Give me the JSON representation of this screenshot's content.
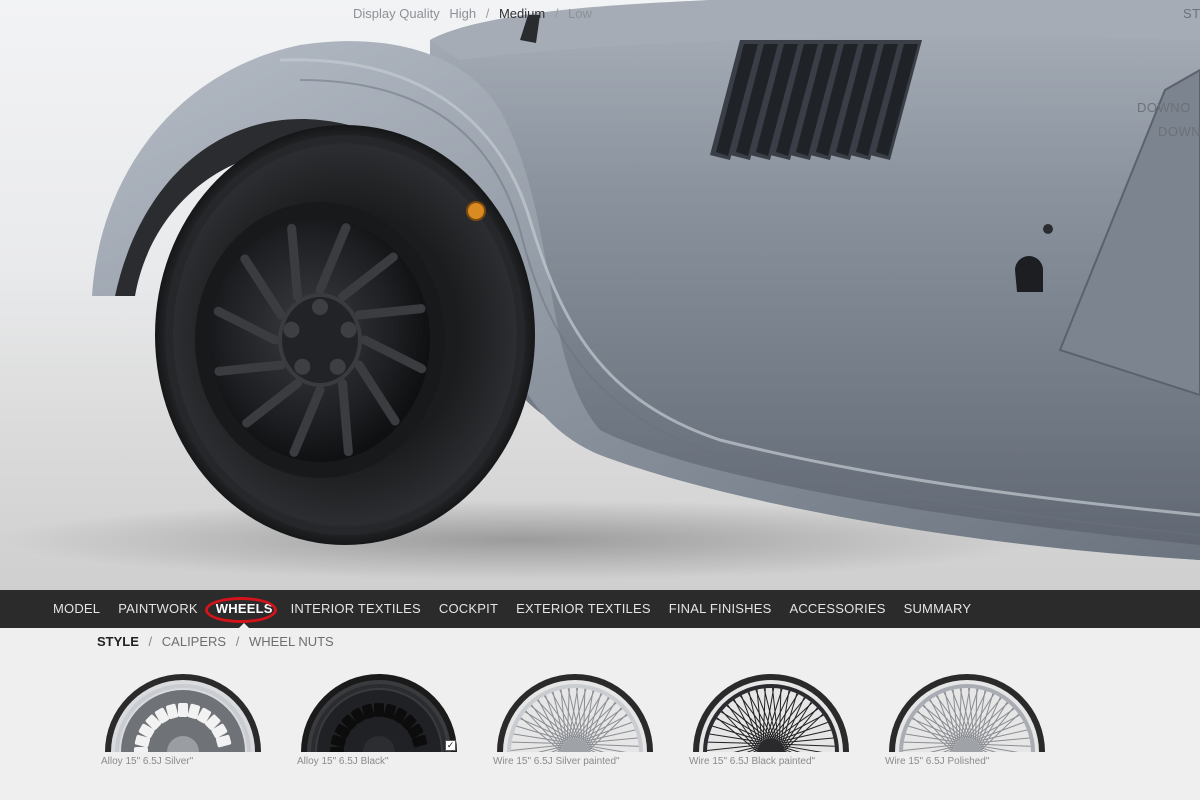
{
  "display_quality": {
    "label": "Display Quality",
    "options": [
      "High",
      "Medium",
      "Low"
    ],
    "selected": "Medium",
    "separator": "/"
  },
  "corner_top_text": "ST",
  "download_links": [
    "DOWNO",
    "DOWN"
  ],
  "main_nav": {
    "items": [
      "MODEL",
      "PAINTWORK",
      "WHEELS",
      "INTERIOR TEXTILES",
      "COCKPIT",
      "EXTERIOR TEXTILES",
      "FINAL FINISHES",
      "ACCESSORIES",
      "SUMMARY"
    ],
    "active": "WHEELS",
    "highlight_color": "#d4131b"
  },
  "sub_nav": {
    "items": [
      "STYLE",
      "CALIPERS",
      "WHEEL NUTS"
    ],
    "active": "STYLE",
    "separator": "/"
  },
  "wheels": [
    {
      "label": "Alloy 15\" 6.5J Silver\"",
      "type": "alloy",
      "finish": "silver",
      "selected": false
    },
    {
      "label": "Alloy 15\" 6.5J Black\"",
      "type": "alloy",
      "finish": "black",
      "selected": true
    },
    {
      "label": "Wire 15\" 6.5J Silver painted\"",
      "type": "wire",
      "finish": "silver",
      "selected": false
    },
    {
      "label": "Wire 15\" 6.5J Black painted\"",
      "type": "wire",
      "finish": "black",
      "selected": false
    },
    {
      "label": "Wire 15\" 6.5J Polished\"",
      "type": "wire",
      "finish": "polished",
      "selected": false
    }
  ],
  "colors": {
    "car_body": "#8e959f",
    "nav_background": "#2b2b2b",
    "accent_ring": "#d4131b"
  }
}
